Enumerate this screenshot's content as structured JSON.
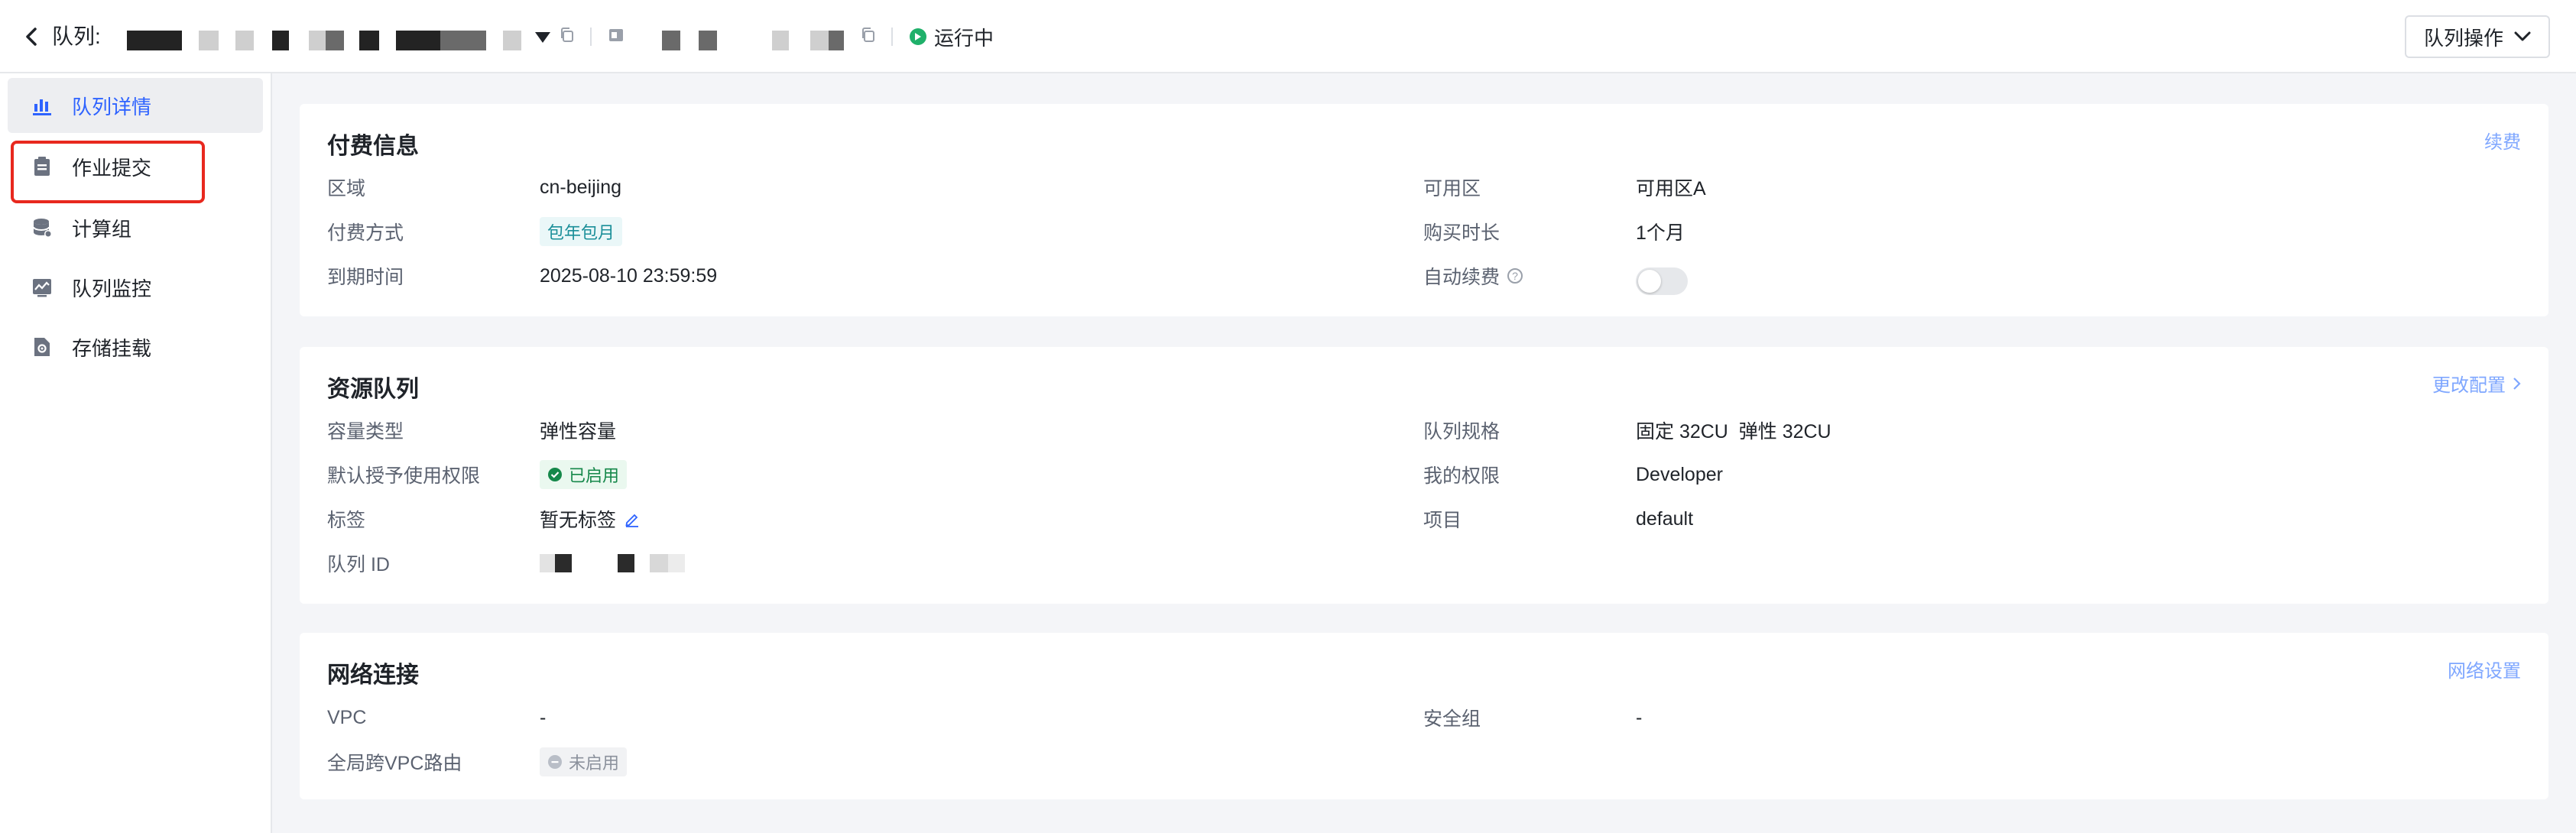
{
  "header": {
    "back_icon": "chevron-left-icon",
    "title_label": "队列:",
    "status": "运行中",
    "status_color": "#1fb06a",
    "queue_action_label": "队列操作"
  },
  "sidebar": {
    "items": [
      {
        "label": "队列详情",
        "icon": "bar-chart-icon"
      },
      {
        "label": "作业提交",
        "icon": "clipboard-icon"
      },
      {
        "label": "计算组",
        "icon": "database-icon"
      },
      {
        "label": "队列监控",
        "icon": "monitor-chart-icon"
      },
      {
        "label": "存储挂载",
        "icon": "file-settings-icon"
      }
    ],
    "active_color": "#2e63ff",
    "highlight_color": "#e8281e"
  },
  "billing": {
    "title": "付费信息",
    "action": "续费",
    "region_label": "区域",
    "region_value": "cn-beijing",
    "zone_label": "可用区",
    "zone_value": "可用区A",
    "pay_mode_label": "付费方式",
    "pay_mode_value": "包年包月",
    "duration_label": "购买时长",
    "duration_value": "1个月",
    "expire_label": "到期时间",
    "expire_value": "2025-08-10 23:59:59",
    "auto_renew_label": "自动续费",
    "auto_renew_on": false
  },
  "resource": {
    "title": "资源队列",
    "action": "更改配置",
    "capacity_type_label": "容量类型",
    "capacity_type_value": "弹性容量",
    "spec_label": "队列规格",
    "spec_value": "固定 32CU  弹性 32CU",
    "default_grant_label": "默认授予使用权限",
    "default_grant_value": "已启用",
    "permission_label": "我的权限",
    "permission_value": "Developer",
    "tag_label": "标签",
    "tag_value": "暂无标签",
    "project_label": "项目",
    "project_value": "default",
    "queue_id_label": "队列 ID"
  },
  "network": {
    "title": "网络连接",
    "action": "网络设置",
    "vpc_label": "VPC",
    "vpc_value": "-",
    "security_group_label": "安全组",
    "security_group_value": "-",
    "global_route_label": "全局跨VPC路由",
    "global_route_value": "未启用"
  }
}
